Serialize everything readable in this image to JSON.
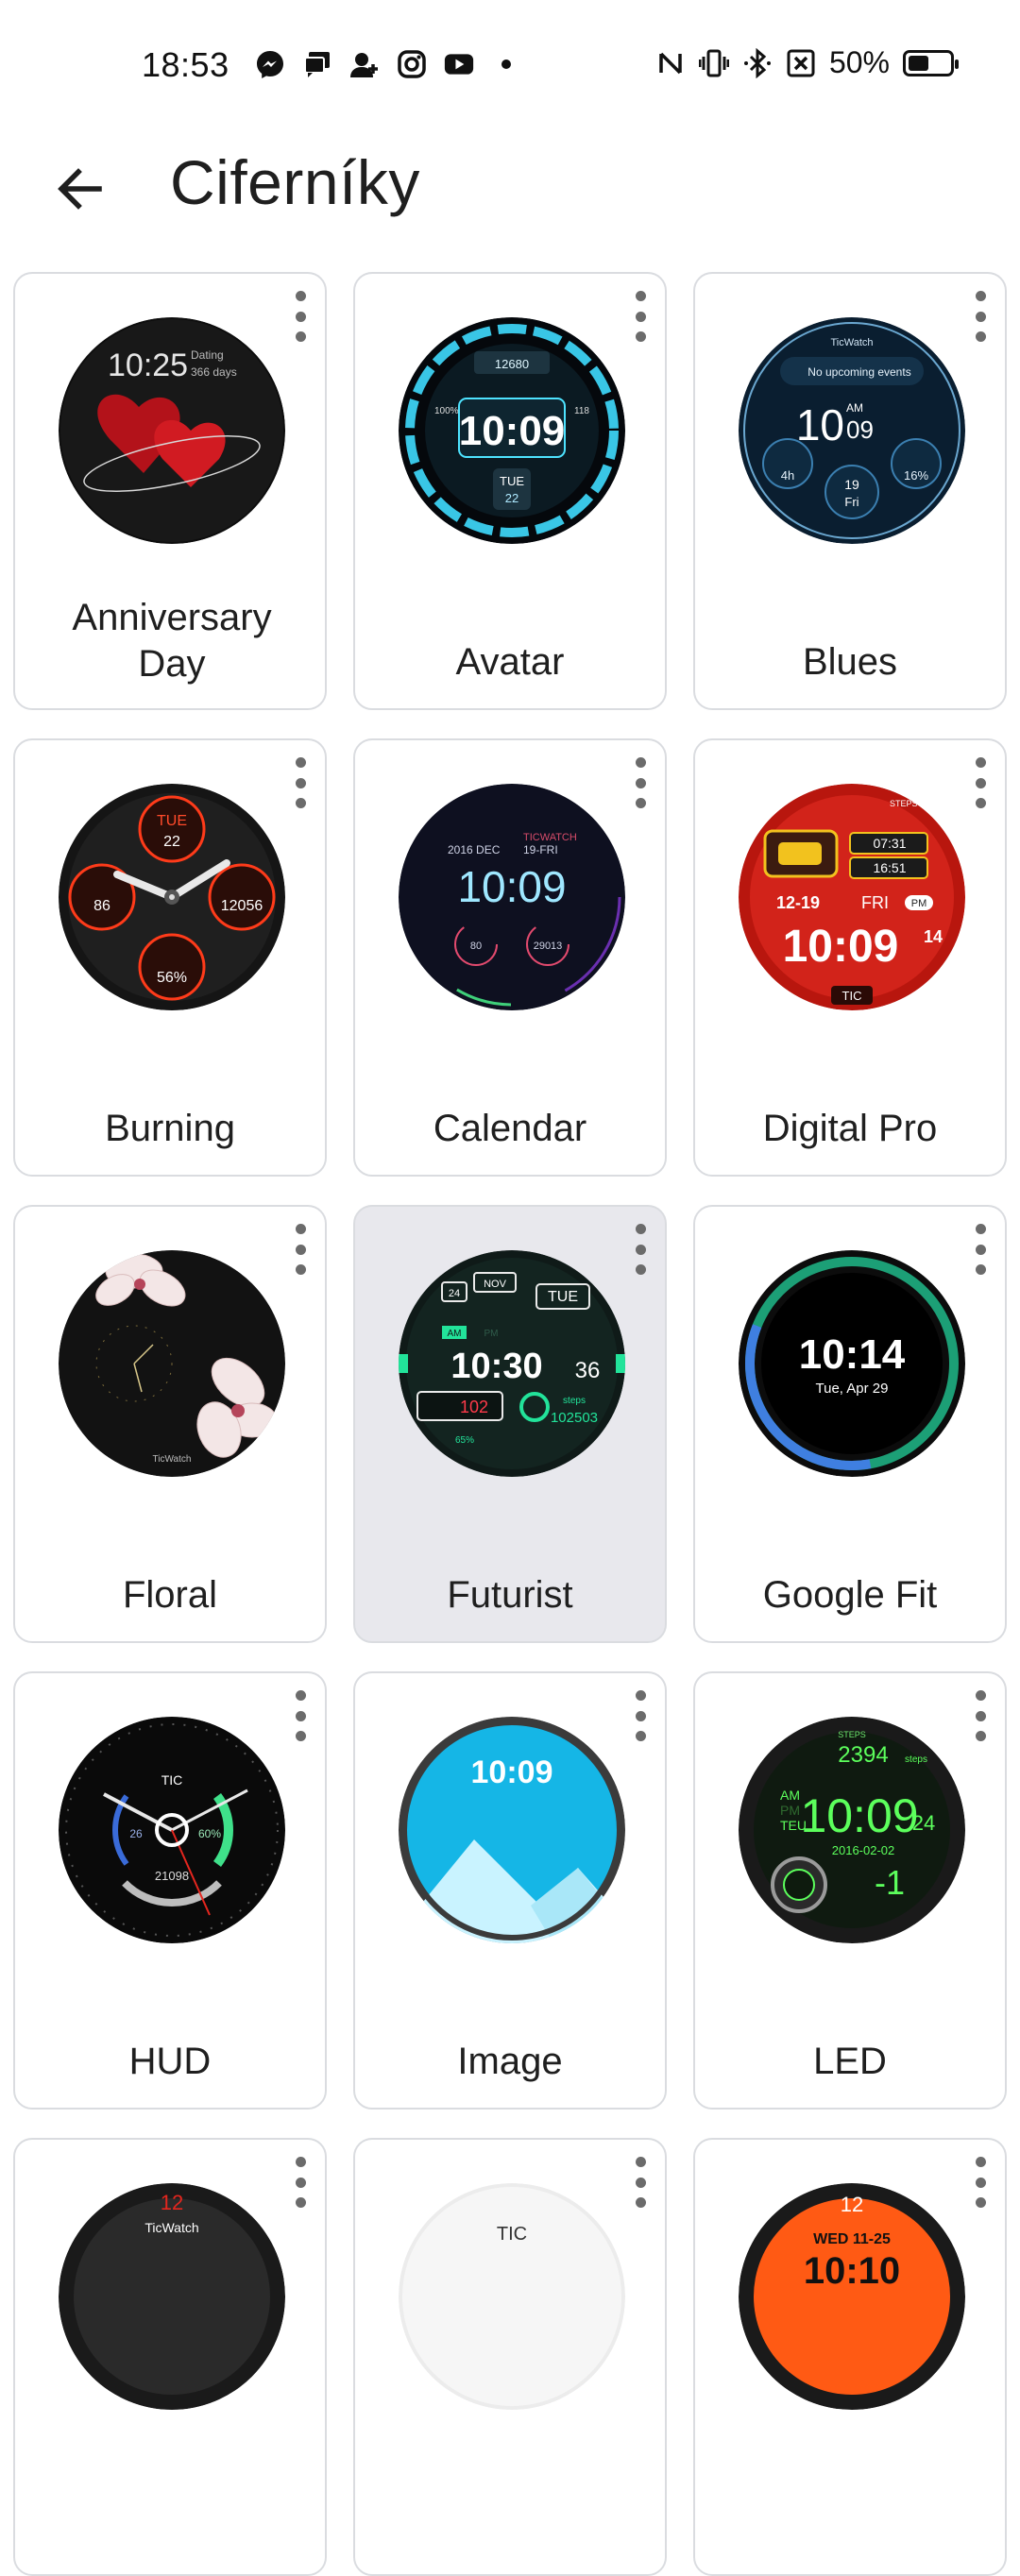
{
  "status_bar": {
    "time": "18:53",
    "left_icons": [
      "messenger-icon",
      "chat-icon",
      "person-add-icon",
      "instagram-icon",
      "youtube-icon",
      "dot-icon"
    ],
    "right_icons": [
      "nfc-icon",
      "vibrate-icon",
      "bluetooth-icon",
      "no-sim-icon"
    ],
    "battery_text": "50%",
    "battery_level": 0.5
  },
  "app_bar": {
    "title": "Ciferníky"
  },
  "watch_faces": [
    {
      "name": "Anniversary Day",
      "time": "10:25",
      "extra": "Dating",
      "extra2": "366 days"
    },
    {
      "name": "Avatar",
      "time": "10:09",
      "steps": "12680",
      "day": "TUE",
      "date": "22",
      "pct": "100%",
      "hr": "118"
    },
    {
      "name": "Blues",
      "brand": "TicWatch",
      "events": "No upcoming events",
      "hour": "10",
      "ampm": "AM",
      "minute": "09",
      "left": "4h",
      "day_num": "19",
      "day": "Fri",
      "right": "16%"
    },
    {
      "name": "Burning",
      "day": "TUE",
      "date": "22",
      "hr": "86",
      "steps": "12056",
      "battery": "56%"
    },
    {
      "name": "Calendar",
      "date": "2016 DEC",
      "brand": "TICWATCH",
      "day": "19-FRI",
      "time": "10:09",
      "left": "80",
      "right": "29013"
    },
    {
      "name": "Digital Pro",
      "steps_label": "STEPS",
      "sunrise": "07:31",
      "sunset": "16:51",
      "date": "12-19",
      "day": "FRI",
      "ampm": "PM",
      "time": "10:09",
      "seconds": "14",
      "brand": "TIC"
    },
    {
      "name": "Floral",
      "brand": "TicWatch"
    },
    {
      "name": "Futurist",
      "num": "24",
      "month": "NOV",
      "day": "TUE",
      "am": "AM",
      "pm": "PM",
      "time": "10:30",
      "seconds": "36",
      "hr": "102",
      "steps_label": "steps",
      "steps": "102503",
      "battery": "65%"
    },
    {
      "name": "Google Fit",
      "time": "10:14",
      "date": "Tue, Apr 29"
    },
    {
      "name": "HUD",
      "brand": "TIC",
      "steps": "21098",
      "left": "26",
      "right": "60%"
    },
    {
      "name": "Image",
      "time": "10:09"
    },
    {
      "name": "LED",
      "steps_label": "STEPS",
      "steps": "2394",
      "steps_unit": "steps",
      "am": "AM",
      "pm": "PM",
      "day": "TEU",
      "time": "10:09",
      "date": "2016-02-02",
      "temp": "-1",
      "side_digits": "24"
    },
    {
      "name": "",
      "brand": "TicWatch",
      "num": "12"
    },
    {
      "name": "",
      "brand": "TIC"
    },
    {
      "name": "",
      "num": "12",
      "date": "WED 11-25",
      "time": "10:10"
    }
  ],
  "colors": {
    "card_border": "#dadce0",
    "selected_card": "#e8e8ed",
    "accent_green": "#22e39a",
    "accent_red": "#e5261e"
  }
}
